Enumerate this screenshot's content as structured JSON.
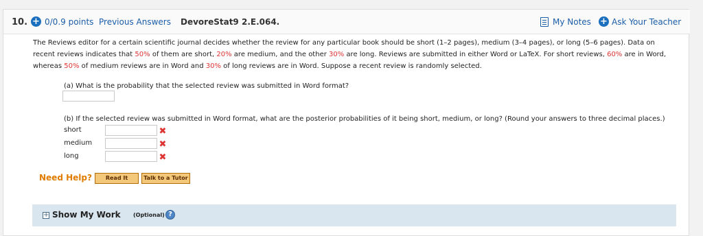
{
  "header": {
    "question_number": "10.",
    "points": "0/0.9 points",
    "previous_answers": "Previous Answers",
    "question_id": "DevoreStat9 2.E.064.",
    "my_notes": "My Notes",
    "ask_teacher": "Ask Your Teacher"
  },
  "problem": {
    "t1": "The Reviews editor for a certain scientific journal decides whether the review for any particular book should be short (1–2 pages), medium (3–4 pages), or long (5–6 pages). Data on recent reviews indicates that ",
    "p1": "50%",
    "t2": " of them are short, ",
    "p2": "20%",
    "t3": " are medium, and the other ",
    "p3": "30%",
    "t4": " are long. Reviews are submitted in either Word or LaTeX. For short reviews, ",
    "p4": "60%",
    "t5": " are in Word, whereas ",
    "p5": "50%",
    "t6": " of medium reviews are in Word and ",
    "p6": "30%",
    "t7": " of long reviews are in Word. Suppose a recent review is randomly selected."
  },
  "part_a": {
    "question": "(a) What is the probability that the selected review was submitted in Word format?",
    "answer": ""
  },
  "part_b": {
    "question": "(b) If the selected review was submitted in Word format, what are the posterior probabilities of it being short, medium, or long? (Round your answers to three decimal places.)",
    "rows": [
      {
        "label": "short",
        "value": "",
        "status": "incorrect"
      },
      {
        "label": "medium",
        "value": "",
        "status": "incorrect"
      },
      {
        "label": "long",
        "value": "",
        "status": "incorrect"
      }
    ]
  },
  "help": {
    "label": "Need Help?",
    "read_it": "Read It",
    "talk_tutor": "Talk to a Tutor"
  },
  "work": {
    "label": "Show My Work",
    "optional": "(Optional)"
  },
  "colors": {
    "link": "#1a5da8",
    "accent_blue": "#1a6fbe",
    "error_red": "#dd3333",
    "help_orange": "#e07c00"
  },
  "icons": {
    "points": "plus-circle-icon",
    "notes": "notes-icon",
    "ask": "plus-circle-icon",
    "incorrect": "x-mark-icon",
    "expand": "expand-plus-icon",
    "help": "question-circle-icon"
  }
}
